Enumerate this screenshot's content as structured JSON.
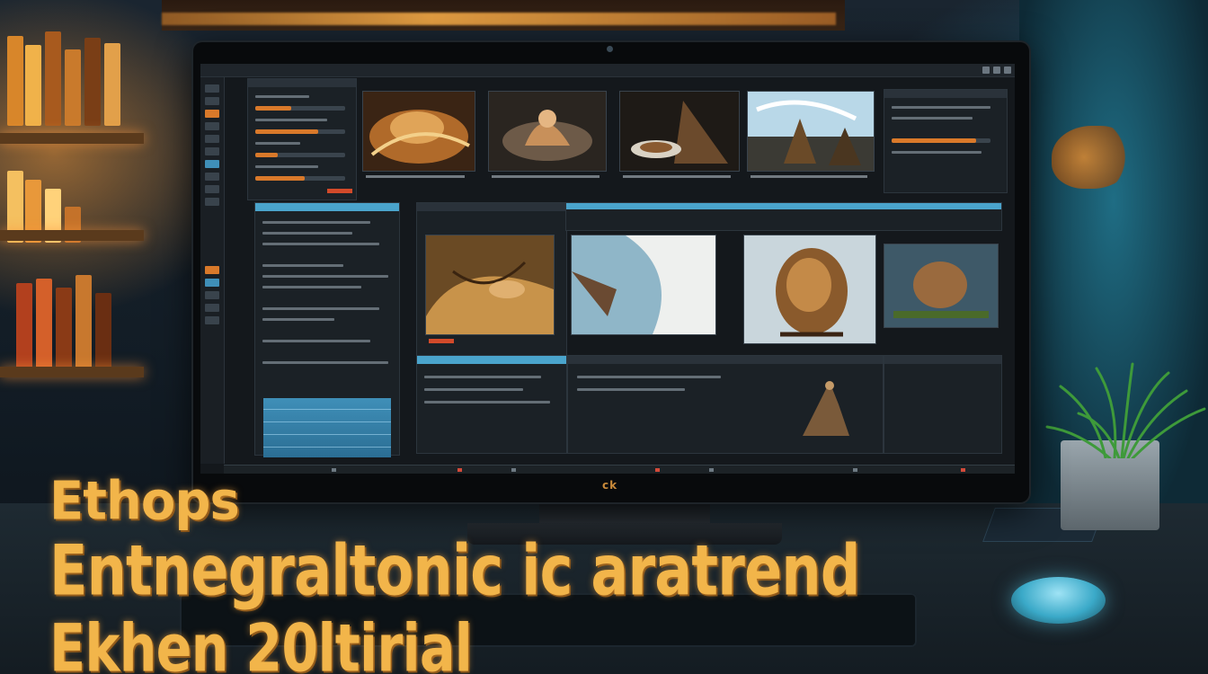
{
  "overlay": {
    "line1": "Ethops",
    "line2": "Entnegraltonic ic aratrend",
    "line3": "Ekhen 20ltirial"
  },
  "monitor": {
    "brand": "ck"
  },
  "colors": {
    "title_gold": "#f2b54a",
    "ui_accent_orange": "#d9792a",
    "ui_accent_blue": "#4aa4cc",
    "shelf_glow": "#ffb24a",
    "room_teal": "#1f6d84"
  },
  "icons": [
    "window-minimize-icon",
    "window-maximize-icon",
    "window-close-icon"
  ]
}
